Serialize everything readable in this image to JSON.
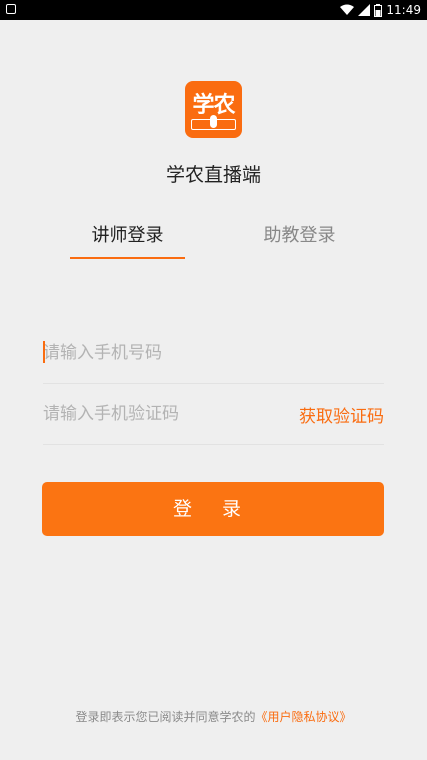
{
  "status_bar": {
    "time": "11:49"
  },
  "logo": {
    "text": "学农"
  },
  "app": {
    "title": "学农直播端"
  },
  "tabs": [
    {
      "label": "讲师登录",
      "active": true
    },
    {
      "label": "助教登录",
      "active": false
    }
  ],
  "form": {
    "phone_placeholder": "请输入手机号码",
    "code_placeholder": "请输入手机验证码",
    "get_code_label": "获取验证码",
    "login_label": "登 录"
  },
  "footer": {
    "text": "登录即表示您已阅读并同意学农的",
    "link": "《用户隐私协议》"
  },
  "colors": {
    "accent": "#fa6c10",
    "background": "#efefef"
  }
}
